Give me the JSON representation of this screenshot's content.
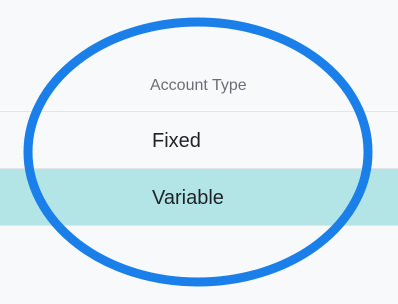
{
  "table": {
    "column_header": "Account Type",
    "rows": [
      {
        "label": "Fixed",
        "selected": false
      },
      {
        "label": "Variable",
        "selected": true
      }
    ]
  },
  "colors": {
    "selected_row": "#b3e5e7",
    "highlight_ring": "#1a7fe8",
    "background": "#f8f9fa"
  }
}
